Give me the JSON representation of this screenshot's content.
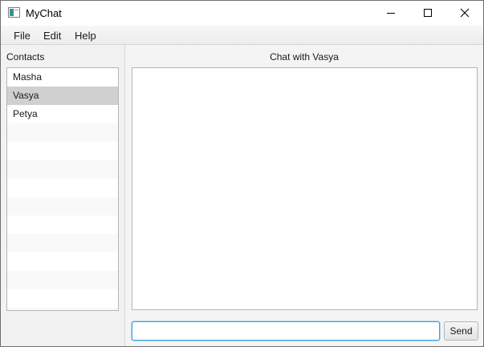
{
  "window": {
    "title": "MyChat",
    "controls": {
      "minimize_icon": "minimize-icon",
      "maximize_icon": "maximize-icon",
      "close_icon": "close-icon"
    }
  },
  "menu": {
    "items": [
      {
        "label": "File"
      },
      {
        "label": "Edit"
      },
      {
        "label": "Help"
      }
    ]
  },
  "contacts": {
    "label": "Contacts",
    "items": [
      {
        "name": "Masha",
        "selected": false
      },
      {
        "name": "Vasya",
        "selected": true
      },
      {
        "name": "Petya",
        "selected": false
      }
    ]
  },
  "chat": {
    "title": "Chat with Vasya",
    "input_value": "",
    "send_label": "Send"
  },
  "colors": {
    "selected_row": "#d0d0d0",
    "input_focus_border": "#3da0d8",
    "app_icon_accent": "#3c8f86"
  }
}
